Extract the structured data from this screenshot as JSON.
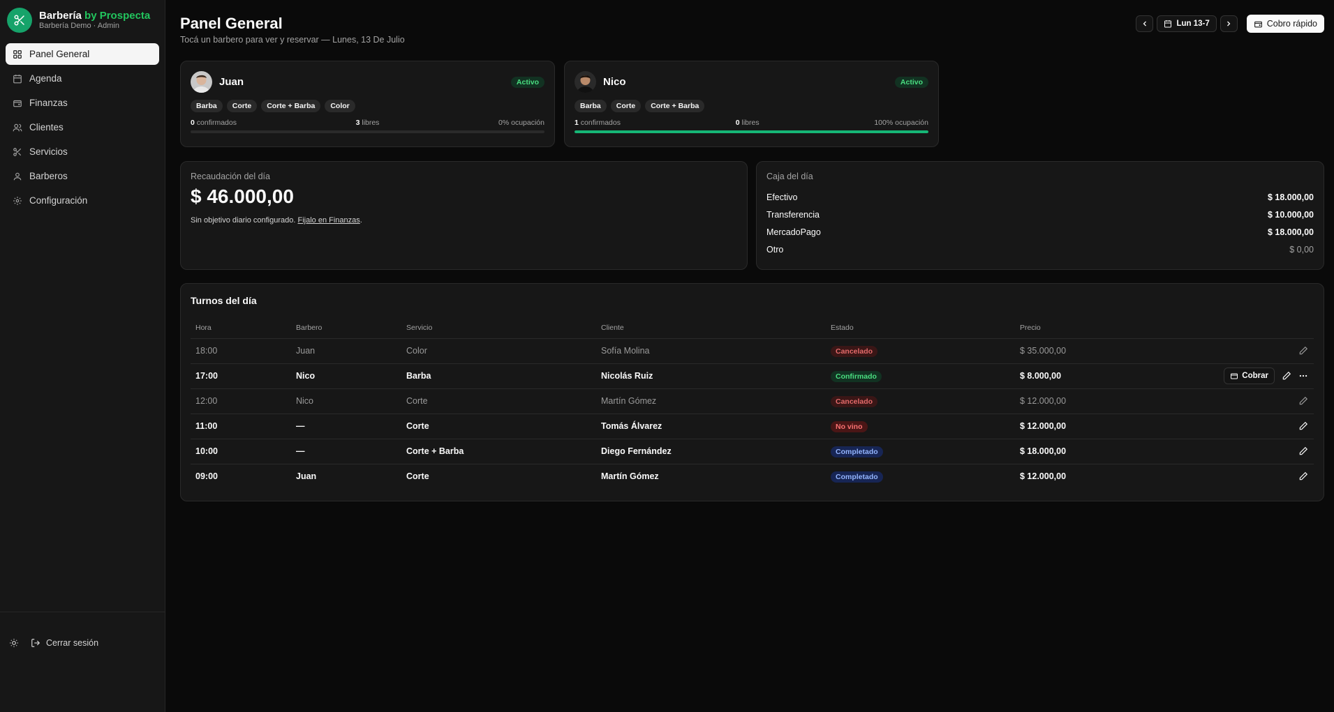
{
  "brand": {
    "name": "Barbería",
    "name_accent": "by Prospecta",
    "subtitle": "Barbería Demo · Admin",
    "accent_color": "#16a36a"
  },
  "sidebar": {
    "items": [
      {
        "label": "Panel General",
        "icon": "grid-icon",
        "active": true
      },
      {
        "label": "Agenda",
        "icon": "calendar-icon"
      },
      {
        "label": "Finanzas",
        "icon": "wallet-icon"
      },
      {
        "label": "Clientes",
        "icon": "users-icon"
      },
      {
        "label": "Servicios",
        "icon": "scissors-icon"
      },
      {
        "label": "Barberos",
        "icon": "user-icon"
      },
      {
        "label": "Configuración",
        "icon": "gear-icon"
      }
    ],
    "logout_label": "Cerrar sesión"
  },
  "header": {
    "title": "Panel General",
    "subtitle": "Tocá un barbero para ver y reservar — Lunes, 13 De Julio",
    "date_label": "Lun 13-7",
    "quick_charge_label": "Cobro rápido"
  },
  "barbers": [
    {
      "name": "Juan",
      "status": "Activo",
      "services": [
        "Barba",
        "Corte",
        "Corte + Barba",
        "Color"
      ],
      "confirmed": "0",
      "confirmed_label": "confirmados",
      "free": "3",
      "free_label": "libres",
      "occupancy": "0% ocupación",
      "occupancy_fraction": 0
    },
    {
      "name": "Nico",
      "status": "Activo",
      "services": [
        "Barba",
        "Corte",
        "Corte + Barba"
      ],
      "confirmed": "1",
      "confirmed_label": "confirmados",
      "free": "0",
      "free_label": "libres",
      "occupancy": "100% ocupación",
      "occupancy_fraction": 1
    }
  ],
  "revenue": {
    "label": "Recaudación del día",
    "amount": "$ 46.000,00",
    "note_prefix": "Sin objetivo diario configurado.",
    "note_link": "Fijalo en Finanzas",
    "note_suffix": "."
  },
  "caja": {
    "label": "Caja del día",
    "rows": [
      {
        "method": "Efectivo",
        "amount": "$ 18.000,00"
      },
      {
        "method": "Transferencia",
        "amount": "$ 10.000,00"
      },
      {
        "method": "MercadoPago",
        "amount": "$ 18.000,00"
      },
      {
        "method": "Otro",
        "amount": "$ 0,00"
      }
    ]
  },
  "turnos": {
    "title": "Turnos del día",
    "columns": [
      "Hora",
      "Barbero",
      "Servicio",
      "Cliente",
      "Estado",
      "Precio"
    ],
    "rows": [
      {
        "hora": "18:00",
        "barbero": "Juan",
        "servicio": "Color",
        "cliente": "Sofía Molina",
        "estado": "Cancelado",
        "precio": "$ 35.000,00"
      },
      {
        "hora": "17:00",
        "barbero": "Nico",
        "servicio": "Barba",
        "cliente": "Nicolás Ruiz",
        "estado": "Confirmado",
        "precio": "$ 8.000,00",
        "cobrar_label": "Cobrar"
      },
      {
        "hora": "12:00",
        "barbero": "Nico",
        "servicio": "Corte",
        "cliente": "Martín Gómez",
        "estado": "Cancelado",
        "precio": "$ 12.000,00"
      },
      {
        "hora": "11:00",
        "barbero": "—",
        "servicio": "Corte",
        "cliente": "Tomás Álvarez",
        "estado": "No vino",
        "precio": "$ 12.000,00"
      },
      {
        "hora": "10:00",
        "barbero": "—",
        "servicio": "Corte + Barba",
        "cliente": "Diego Fernández",
        "estado": "Completado",
        "precio": "$ 18.000,00"
      },
      {
        "hora": "09:00",
        "barbero": "Juan",
        "servicio": "Corte",
        "cliente": "Martín Gómez",
        "estado": "Completado",
        "precio": "$ 12.000,00"
      }
    ]
  }
}
